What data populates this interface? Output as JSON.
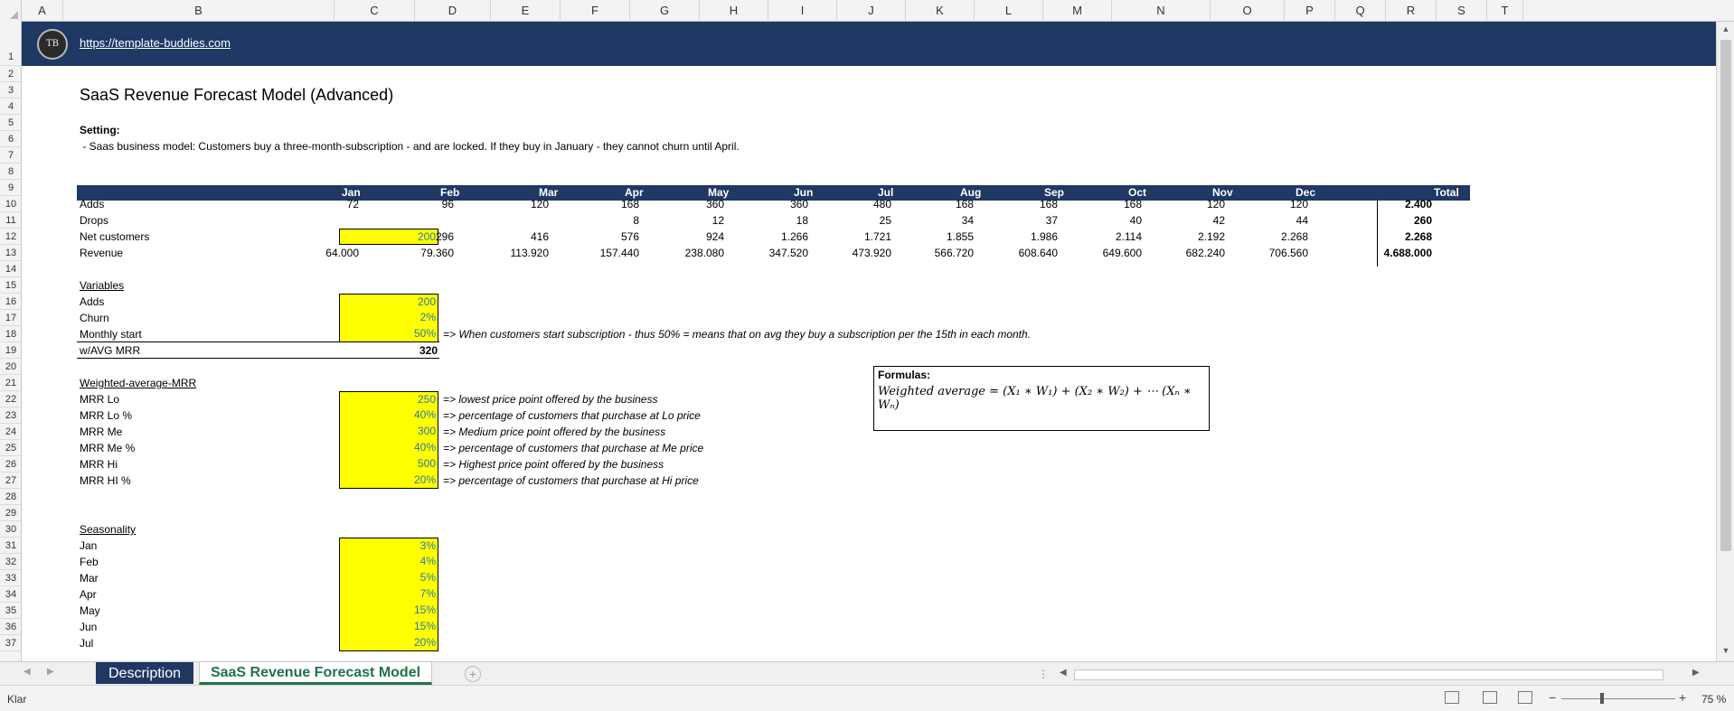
{
  "banner": {
    "link": "https://template-buddies.com",
    "logo_text": "TB"
  },
  "columns": [
    "A",
    "B",
    "C",
    "D",
    "E",
    "F",
    "G",
    "H",
    "I",
    "J",
    "K",
    "L",
    "M",
    "N",
    "O",
    "P",
    "Q",
    "R",
    "S",
    "T"
  ],
  "rows": [
    "1",
    "2",
    "3",
    "4",
    "5",
    "6",
    "7",
    "8",
    "9",
    "10",
    "11",
    "12",
    "13",
    "14",
    "15",
    "16",
    "17",
    "18",
    "19",
    "20",
    "21",
    "22",
    "23",
    "24",
    "25",
    "26",
    "27",
    "28",
    "29",
    "30",
    "31",
    "32",
    "33",
    "34",
    "35",
    "36",
    "37"
  ],
  "title": "SaaS Revenue Forecast Model (Advanced)",
  "setting": {
    "label": "Setting:",
    "desc": " - Saas business model: Customers buy a three-month-subscription - and are locked. If they buy in January - they cannot churn until April."
  },
  "table": {
    "months": [
      "Jan",
      "Feb",
      "Mar",
      "Apr",
      "May",
      "Jun",
      "Jul",
      "Aug",
      "Sep",
      "Oct",
      "Nov",
      "Dec"
    ],
    "total_label": "Total",
    "rows": [
      {
        "label": "Adds",
        "values": [
          "72",
          "96",
          "120",
          "168",
          "360",
          "360",
          "480",
          "168",
          "168",
          "168",
          "120",
          "120"
        ],
        "total": "2.400"
      },
      {
        "label": "Drops",
        "values": [
          "",
          "",
          "",
          "8",
          "12",
          "18",
          "25",
          "34",
          "37",
          "40",
          "42",
          "44"
        ],
        "total": "260"
      },
      {
        "label": "Net customers",
        "values": [
          "200",
          "296",
          "416",
          "576",
          "924",
          "1.266",
          "1.721",
          "1.855",
          "1.986",
          "2.114",
          "2.192",
          "2.268"
        ],
        "total": "2.268"
      },
      {
        "label": "Revenue",
        "values": [
          "64.000",
          "79.360",
          "113.920",
          "157.440",
          "238.080",
          "347.520",
          "473.920",
          "566.720",
          "608.640",
          "649.600",
          "682.240",
          "706.560"
        ],
        "total": "4.688.000"
      }
    ]
  },
  "variables": {
    "title": "Variables",
    "items": [
      {
        "label": "Adds",
        "value": "200",
        "note": ""
      },
      {
        "label": "Churn",
        "value": "2%",
        "note": ""
      },
      {
        "label": "Monthly start",
        "value": "50%",
        "note": "=> When customers start subscription - thus 50% = means that on avg they buy a subscription per the 15th in each month."
      }
    ],
    "avg_label": "w/AVG MRR",
    "avg_value": "320"
  },
  "wamrr": {
    "title": "Weighted-average-MRR",
    "items": [
      {
        "label": "MRR Lo",
        "value": "250",
        "note": "=> lowest price point offered by the business"
      },
      {
        "label": "MRR Lo %",
        "value": "40%",
        "note": "=> percentage of customers that purchase at Lo price"
      },
      {
        "label": "MRR Me",
        "value": "300",
        "note": "=> Medium price point offered by the business"
      },
      {
        "label": "MRR Me %",
        "value": "40%",
        "note": "=> percentage of customers that purchase at Me price"
      },
      {
        "label": "MRR Hi",
        "value": "500",
        "note": "=> Highest price point offered by the business"
      },
      {
        "label": "MRR HI %",
        "value": "20%",
        "note": "=> percentage of customers that purchase at Hi price"
      }
    ]
  },
  "seasonality": {
    "title": "Seasonality",
    "items": [
      {
        "label": "Jan",
        "value": "3%"
      },
      {
        "label": "Feb",
        "value": "4%"
      },
      {
        "label": "Mar",
        "value": "5%"
      },
      {
        "label": "Apr",
        "value": "7%"
      },
      {
        "label": "May",
        "value": "15%"
      },
      {
        "label": "Jun",
        "value": "15%"
      },
      {
        "label": "Jul",
        "value": "20%"
      }
    ]
  },
  "formulas": {
    "label": "Formulas:",
    "text": "Weighted average = (X₁ ∗ W₁) + (X₂ ∗ W₂) + ⋯ (Xₙ ∗ Wₙ)"
  },
  "tabs": {
    "description": "Description",
    "active": "SaaS Revenue Forecast Model",
    "add": "+"
  },
  "status": {
    "text": "Klar",
    "zoom": "75 %"
  }
}
